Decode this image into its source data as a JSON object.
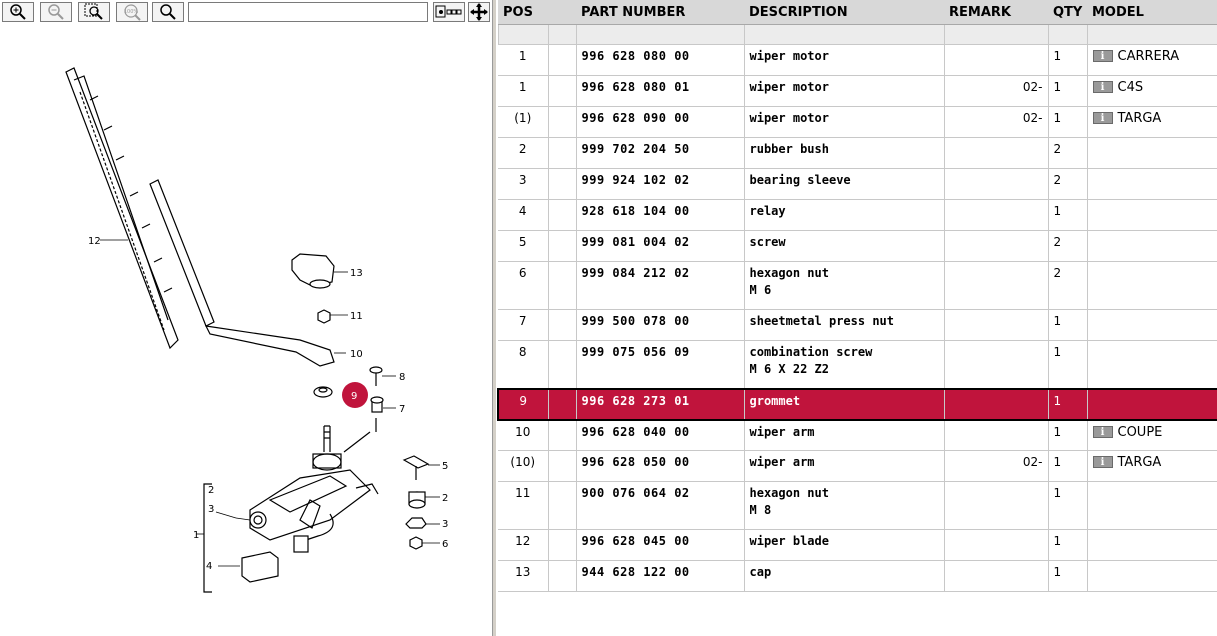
{
  "toolbar": {
    "icons": [
      "zoom-in-icon",
      "zoom-out-icon",
      "zoom-area-icon",
      "zoom-100-icon",
      "search-icon",
      "fit-view-icon",
      "move-icon"
    ],
    "zoom100_label": "100%",
    "search_value": ""
  },
  "diagram": {
    "callouts": [
      "12",
      "13",
      "11",
      "10",
      "8",
      "9",
      "7",
      "5",
      "2",
      "3",
      "6",
      "2",
      "3",
      "1",
      "4"
    ],
    "highlight_label": "9",
    "highlight_color": "#c0143c"
  },
  "table": {
    "headers": [
      "POS",
      "PART NUMBER",
      "DESCRIPTION",
      "REMARK",
      "QTY",
      "MODEL"
    ],
    "rows": [
      {
        "pos": "1",
        "pn": "996 628 080 00",
        "desc": "wiper motor",
        "desc2": "",
        "remark": "",
        "qty": "1",
        "model": "CARRERA",
        "info": true
      },
      {
        "pos": "1",
        "pn": "996 628 080 01",
        "desc": "wiper motor",
        "desc2": "",
        "remark": "02-",
        "qty": "1",
        "model": "C4S",
        "info": true
      },
      {
        "pos": "(1)",
        "pn": "996 628 090 00",
        "desc": "wiper motor",
        "desc2": "",
        "remark": "02-",
        "qty": "1",
        "model": "TARGA",
        "info": true
      },
      {
        "pos": "2",
        "pn": "999 702 204 50",
        "desc": "rubber bush",
        "desc2": "",
        "remark": "",
        "qty": "2",
        "model": "",
        "info": false
      },
      {
        "pos": "3",
        "pn": "999 924 102 02",
        "desc": "bearing sleeve",
        "desc2": "",
        "remark": "",
        "qty": "2",
        "model": "",
        "info": false
      },
      {
        "pos": "4",
        "pn": "928 618 104 00",
        "desc": "relay",
        "desc2": "",
        "remark": "",
        "qty": "1",
        "model": "",
        "info": false
      },
      {
        "pos": "5",
        "pn": "999 081 004 02",
        "desc": "screw",
        "desc2": "",
        "remark": "",
        "qty": "2",
        "model": "",
        "info": false
      },
      {
        "pos": "6",
        "pn": "999 084 212 02",
        "desc": "hexagon nut",
        "desc2": "M 6",
        "remark": "",
        "qty": "2",
        "model": "",
        "info": false
      },
      {
        "pos": "7",
        "pn": "999 500 078 00",
        "desc": "sheetmetal press nut",
        "desc2": "",
        "remark": "",
        "qty": "1",
        "model": "",
        "info": false
      },
      {
        "pos": "8",
        "pn": "999 075 056 09",
        "desc": "combination screw",
        "desc2": "M 6 X 22 Z2",
        "remark": "",
        "qty": "1",
        "model": "",
        "info": false
      },
      {
        "pos": "9",
        "pn": "996 628 273 01",
        "desc": "grommet",
        "desc2": "",
        "remark": "",
        "qty": "1",
        "model": "",
        "info": false,
        "selected": true
      },
      {
        "pos": "10",
        "pn": "996 628 040 00",
        "desc": "wiper arm",
        "desc2": "",
        "remark": "",
        "qty": "1",
        "model": "COUPE",
        "info": true
      },
      {
        "pos": "(10)",
        "pn": "996 628 050 00",
        "desc": "wiper arm",
        "desc2": "",
        "remark": "02-",
        "qty": "1",
        "model": "TARGA",
        "info": true
      },
      {
        "pos": "11",
        "pn": "900 076 064 02",
        "desc": "hexagon nut",
        "desc2": "M 8",
        "remark": "",
        "qty": "1",
        "model": "",
        "info": false
      },
      {
        "pos": "12",
        "pn": "996 628 045 00",
        "desc": "wiper blade",
        "desc2": "",
        "remark": "",
        "qty": "1",
        "model": "",
        "info": false
      },
      {
        "pos": "13",
        "pn": "944 628 122 00",
        "desc": "cap",
        "desc2": "",
        "remark": "",
        "qty": "1",
        "model": "",
        "info": false
      }
    ],
    "info_glyph": "i",
    "selected_color": "#c0143c"
  }
}
